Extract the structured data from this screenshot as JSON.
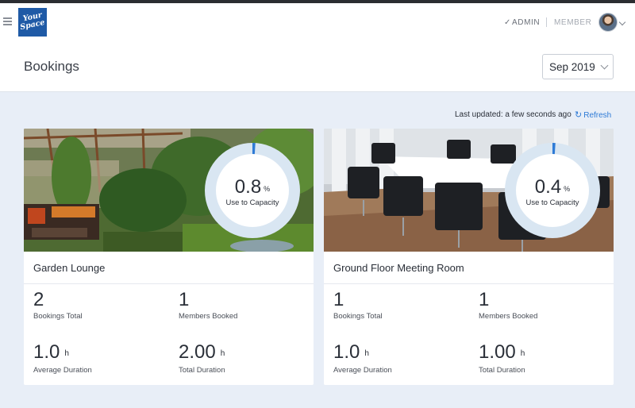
{
  "nav": {
    "logo_line1": "Your",
    "logo_line2": "Space",
    "role_admin": "ADMIN",
    "role_member": "MEMBER"
  },
  "header": {
    "title": "Bookings",
    "month": "Sep 2019"
  },
  "status": {
    "updated": "Last updated: a few seconds ago",
    "refresh": "Refresh"
  },
  "rooms": [
    {
      "name": "Garden Lounge",
      "capacity_value": "0.8",
      "capacity_unit": "%",
      "capacity_label": "Use to Capacity",
      "capacity_fraction": 0.008,
      "bookings_total": "2",
      "bookings_total_label": "Bookings Total",
      "members_booked": "1",
      "members_booked_label": "Members Booked",
      "avg_duration": "1.0",
      "avg_duration_unit": "h",
      "avg_duration_label": "Average Duration",
      "total_duration": "2.00",
      "total_duration_unit": "h",
      "total_duration_label": "Total Duration"
    },
    {
      "name": "Ground Floor Meeting Room",
      "capacity_value": "0.4",
      "capacity_unit": "%",
      "capacity_label": "Use to Capacity",
      "capacity_fraction": 0.004,
      "bookings_total": "1",
      "bookings_total_label": "Bookings Total",
      "members_booked": "1",
      "members_booked_label": "Members Booked",
      "avg_duration": "1.0",
      "avg_duration_unit": "h",
      "avg_duration_label": "Average Duration",
      "total_duration": "1.00",
      "total_duration_unit": "h",
      "total_duration_label": "Total Duration"
    }
  ],
  "colors": {
    "accent": "#2f7bd6",
    "brand": "#1f5aa6",
    "gauge_track": "#d9e6f2",
    "gauge_fill": "#2f7bd6",
    "page_bg": "#e8eef7"
  },
  "icons": {
    "menu": "hamburger-icon",
    "check": "check-icon",
    "refresh": "refresh-icon",
    "caret": "chevron-down-icon"
  }
}
